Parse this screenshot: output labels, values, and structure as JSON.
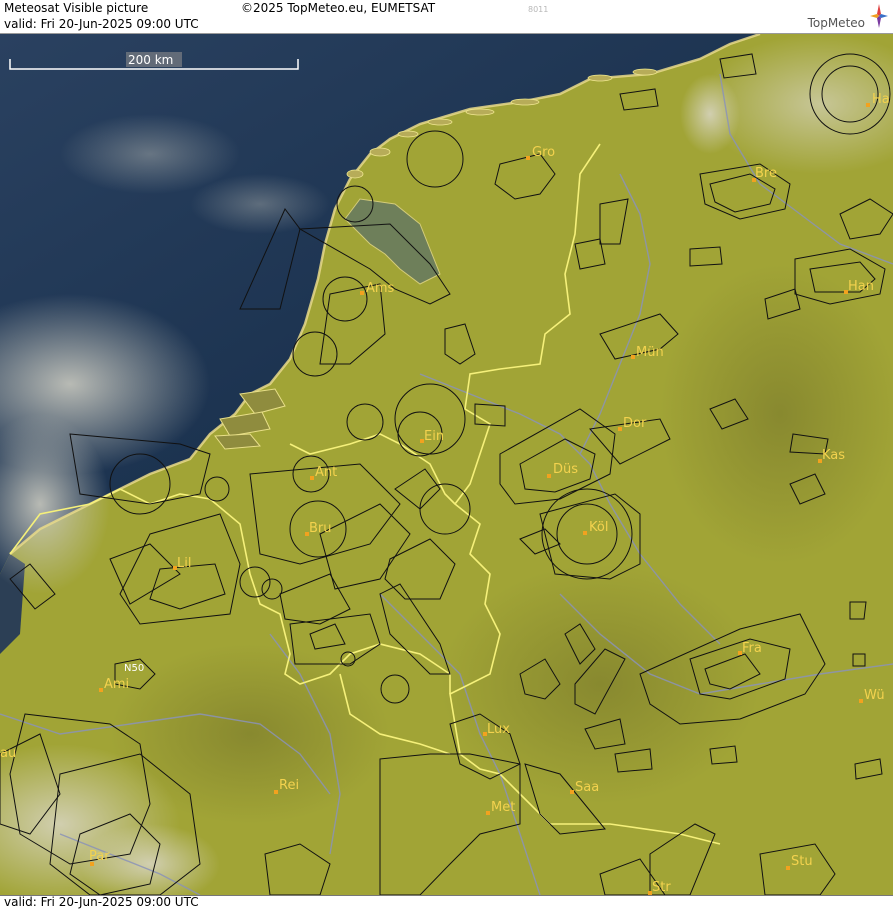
{
  "header": {
    "title": "Meteosat Visible picture",
    "copyright": "©2025 TopMeteo.eu, EUMETSAT",
    "code": "8011",
    "valid": "valid:  Fri  20-Jun-2025  09:00 UTC",
    "brand": "TopMeteo"
  },
  "footer": {
    "valid": "valid:  Fri  20-Jun-2025  09:00 UTC"
  },
  "scale": {
    "label": "200 km"
  },
  "cities": [
    {
      "label": "Gro"
    },
    {
      "label": "Ams"
    },
    {
      "label": "Bre"
    },
    {
      "label": "Ha"
    },
    {
      "label": "Han"
    },
    {
      "label": "Mün"
    },
    {
      "label": "Ein"
    },
    {
      "label": "Dor"
    },
    {
      "label": "Kas"
    },
    {
      "label": "Ant"
    },
    {
      "label": "Düs"
    },
    {
      "label": "Bru"
    },
    {
      "label": "Köl"
    },
    {
      "label": "Lil"
    },
    {
      "label": "Fra"
    },
    {
      "label": "Wü"
    },
    {
      "label": "Ami"
    },
    {
      "label": "N50"
    },
    {
      "label": "Lux"
    },
    {
      "label": "Rei"
    },
    {
      "label": "Saa"
    },
    {
      "label": "Met"
    },
    {
      "label": "Par"
    },
    {
      "label": "Stu"
    },
    {
      "label": "Str"
    },
    {
      "label": "au"
    }
  ],
  "colors": {
    "sea": "#1f3550",
    "land": "#a1a436",
    "border": "#f5f07a",
    "airspace": "#111111",
    "city": "#f3d24e",
    "rivers": "#8b93b8"
  }
}
